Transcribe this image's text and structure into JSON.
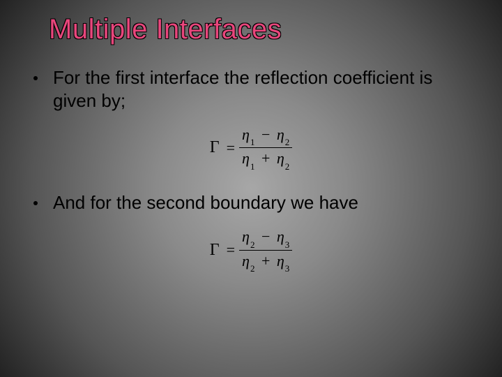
{
  "title": "Multiple Interfaces",
  "bullets": {
    "b1": "For the first interface the reflection coefficient is given by;",
    "b2": "And for the second boundary we have"
  },
  "formulas": {
    "f1": {
      "lhs": "Γ",
      "eq": "=",
      "num_a": "η",
      "num_a_sub": "1",
      "num_op": "−",
      "num_b": "η",
      "num_b_sub": "2",
      "den_a": "η",
      "den_a_sub": "1",
      "den_op": "+",
      "den_b": "η",
      "den_b_sub": "2"
    },
    "f2": {
      "lhs": "Γ",
      "eq": "=",
      "num_a": "η",
      "num_a_sub": "2",
      "num_op": "−",
      "num_b": "η",
      "num_b_sub": "3",
      "den_a": "η",
      "den_a_sub": "2",
      "den_op": "+",
      "den_b": "η",
      "den_b_sub": "3"
    }
  }
}
